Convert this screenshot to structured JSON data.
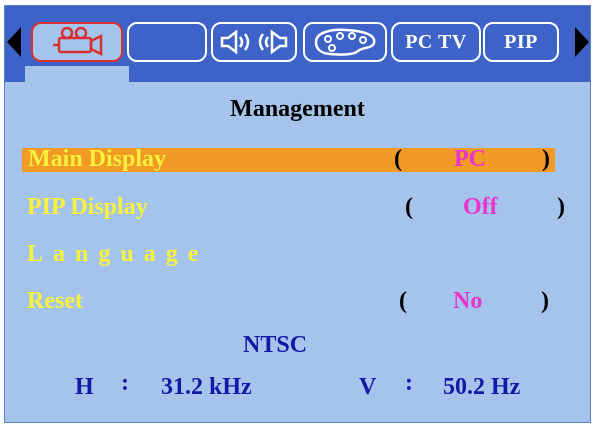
{
  "tabs": [
    {
      "label": "",
      "icon": "projector-icon",
      "active": true
    },
    {
      "label": "",
      "icon": "blank-icon",
      "active": false
    },
    {
      "label": "",
      "icon": "speaker-icon",
      "active": false
    },
    {
      "label": "",
      "icon": "palette-icon",
      "active": false
    },
    {
      "label": "PC TV",
      "icon": "",
      "active": false
    },
    {
      "label": "PIP",
      "icon": "",
      "active": false
    }
  ],
  "menu": {
    "title": "Management",
    "items": [
      {
        "label": "Main Display",
        "value": "PC",
        "selected": true
      },
      {
        "label": "PIP Display",
        "value": "Off",
        "selected": false
      },
      {
        "label": "Language",
        "value": "",
        "selected": false
      },
      {
        "label": "Reset",
        "value": "No",
        "selected": false
      }
    ],
    "open_paren": "(",
    "close_paren": ")"
  },
  "signal": {
    "standard": "NTSC",
    "h_label": "H",
    "h_value": "31.2 kHz",
    "v_label": "V",
    "v_value": "50.2 Hz",
    "separator": ":"
  },
  "colors": {
    "background": "#a4c4ec",
    "tab_bar": "#3d63c8",
    "highlight": "#f19a26",
    "label": "#f8f23c",
    "value": "#e934d0",
    "info": "#1219a6"
  }
}
